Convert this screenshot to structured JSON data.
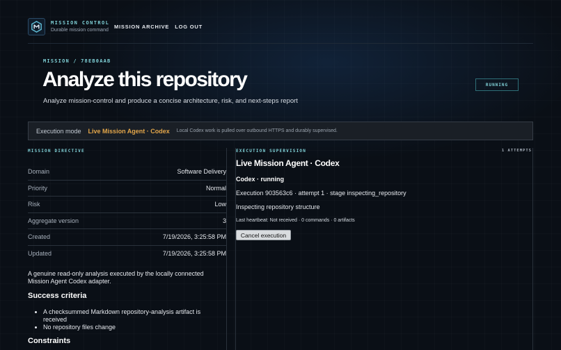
{
  "brand": {
    "title": "MISSION CONTROL",
    "subtitle": "Durable mission command"
  },
  "nav": {
    "archive": "MISSION ARCHIVE",
    "logout": "LOG OUT"
  },
  "mission": {
    "breadcrumb": "MISSION / 78EB0AAB",
    "title": "Analyze this repository",
    "subtitle": "Analyze mission-control and produce a concise architecture, risk, and next-steps report",
    "status": "RUNNING"
  },
  "execution_mode": {
    "label": "Execution mode",
    "value": "Live Mission Agent · Codex",
    "description": "Local Codex work is pulled over outbound HTTPS and durably supervised."
  },
  "directive": {
    "section_label": "MISSION DIRECTIVE",
    "rows": [
      {
        "key": "Domain",
        "value": "Software Delivery"
      },
      {
        "key": "Priority",
        "value": "Normal"
      },
      {
        "key": "Risk",
        "value": "Low"
      },
      {
        "key": "Aggregate version",
        "value": "3"
      },
      {
        "key": "Created",
        "value": "7/19/2026, 3:25:58 PM"
      },
      {
        "key": "Updated",
        "value": "7/19/2026, 3:25:58 PM"
      }
    ],
    "description": "A genuine read-only analysis executed by the locally connected Mission Agent Codex adapter.",
    "success_heading": "Success criteria",
    "success_criteria": [
      "A checksummed Markdown repository-analysis artifact is received",
      "No repository files change"
    ],
    "constraints_heading": "Constraints"
  },
  "supervision": {
    "section_label": "EXECUTION SUPERVISION",
    "attempts": "1 ATTEMPTS",
    "agent_title": "Live Mission Agent · Codex",
    "agent_state": "Codex · running",
    "execution_line": "Execution 903563c6 · attempt 1 · stage inspecting_repository",
    "inspect_line": "Inspecting repository structure",
    "heartbeat": "Last heartbeat: Not received · 0 commands · 0 artifacts",
    "cancel_label": "Cancel execution"
  },
  "colors": {
    "accent": "#7fd0d6",
    "mode_highlight": "#e3a64a",
    "background": "#0a0f16"
  }
}
